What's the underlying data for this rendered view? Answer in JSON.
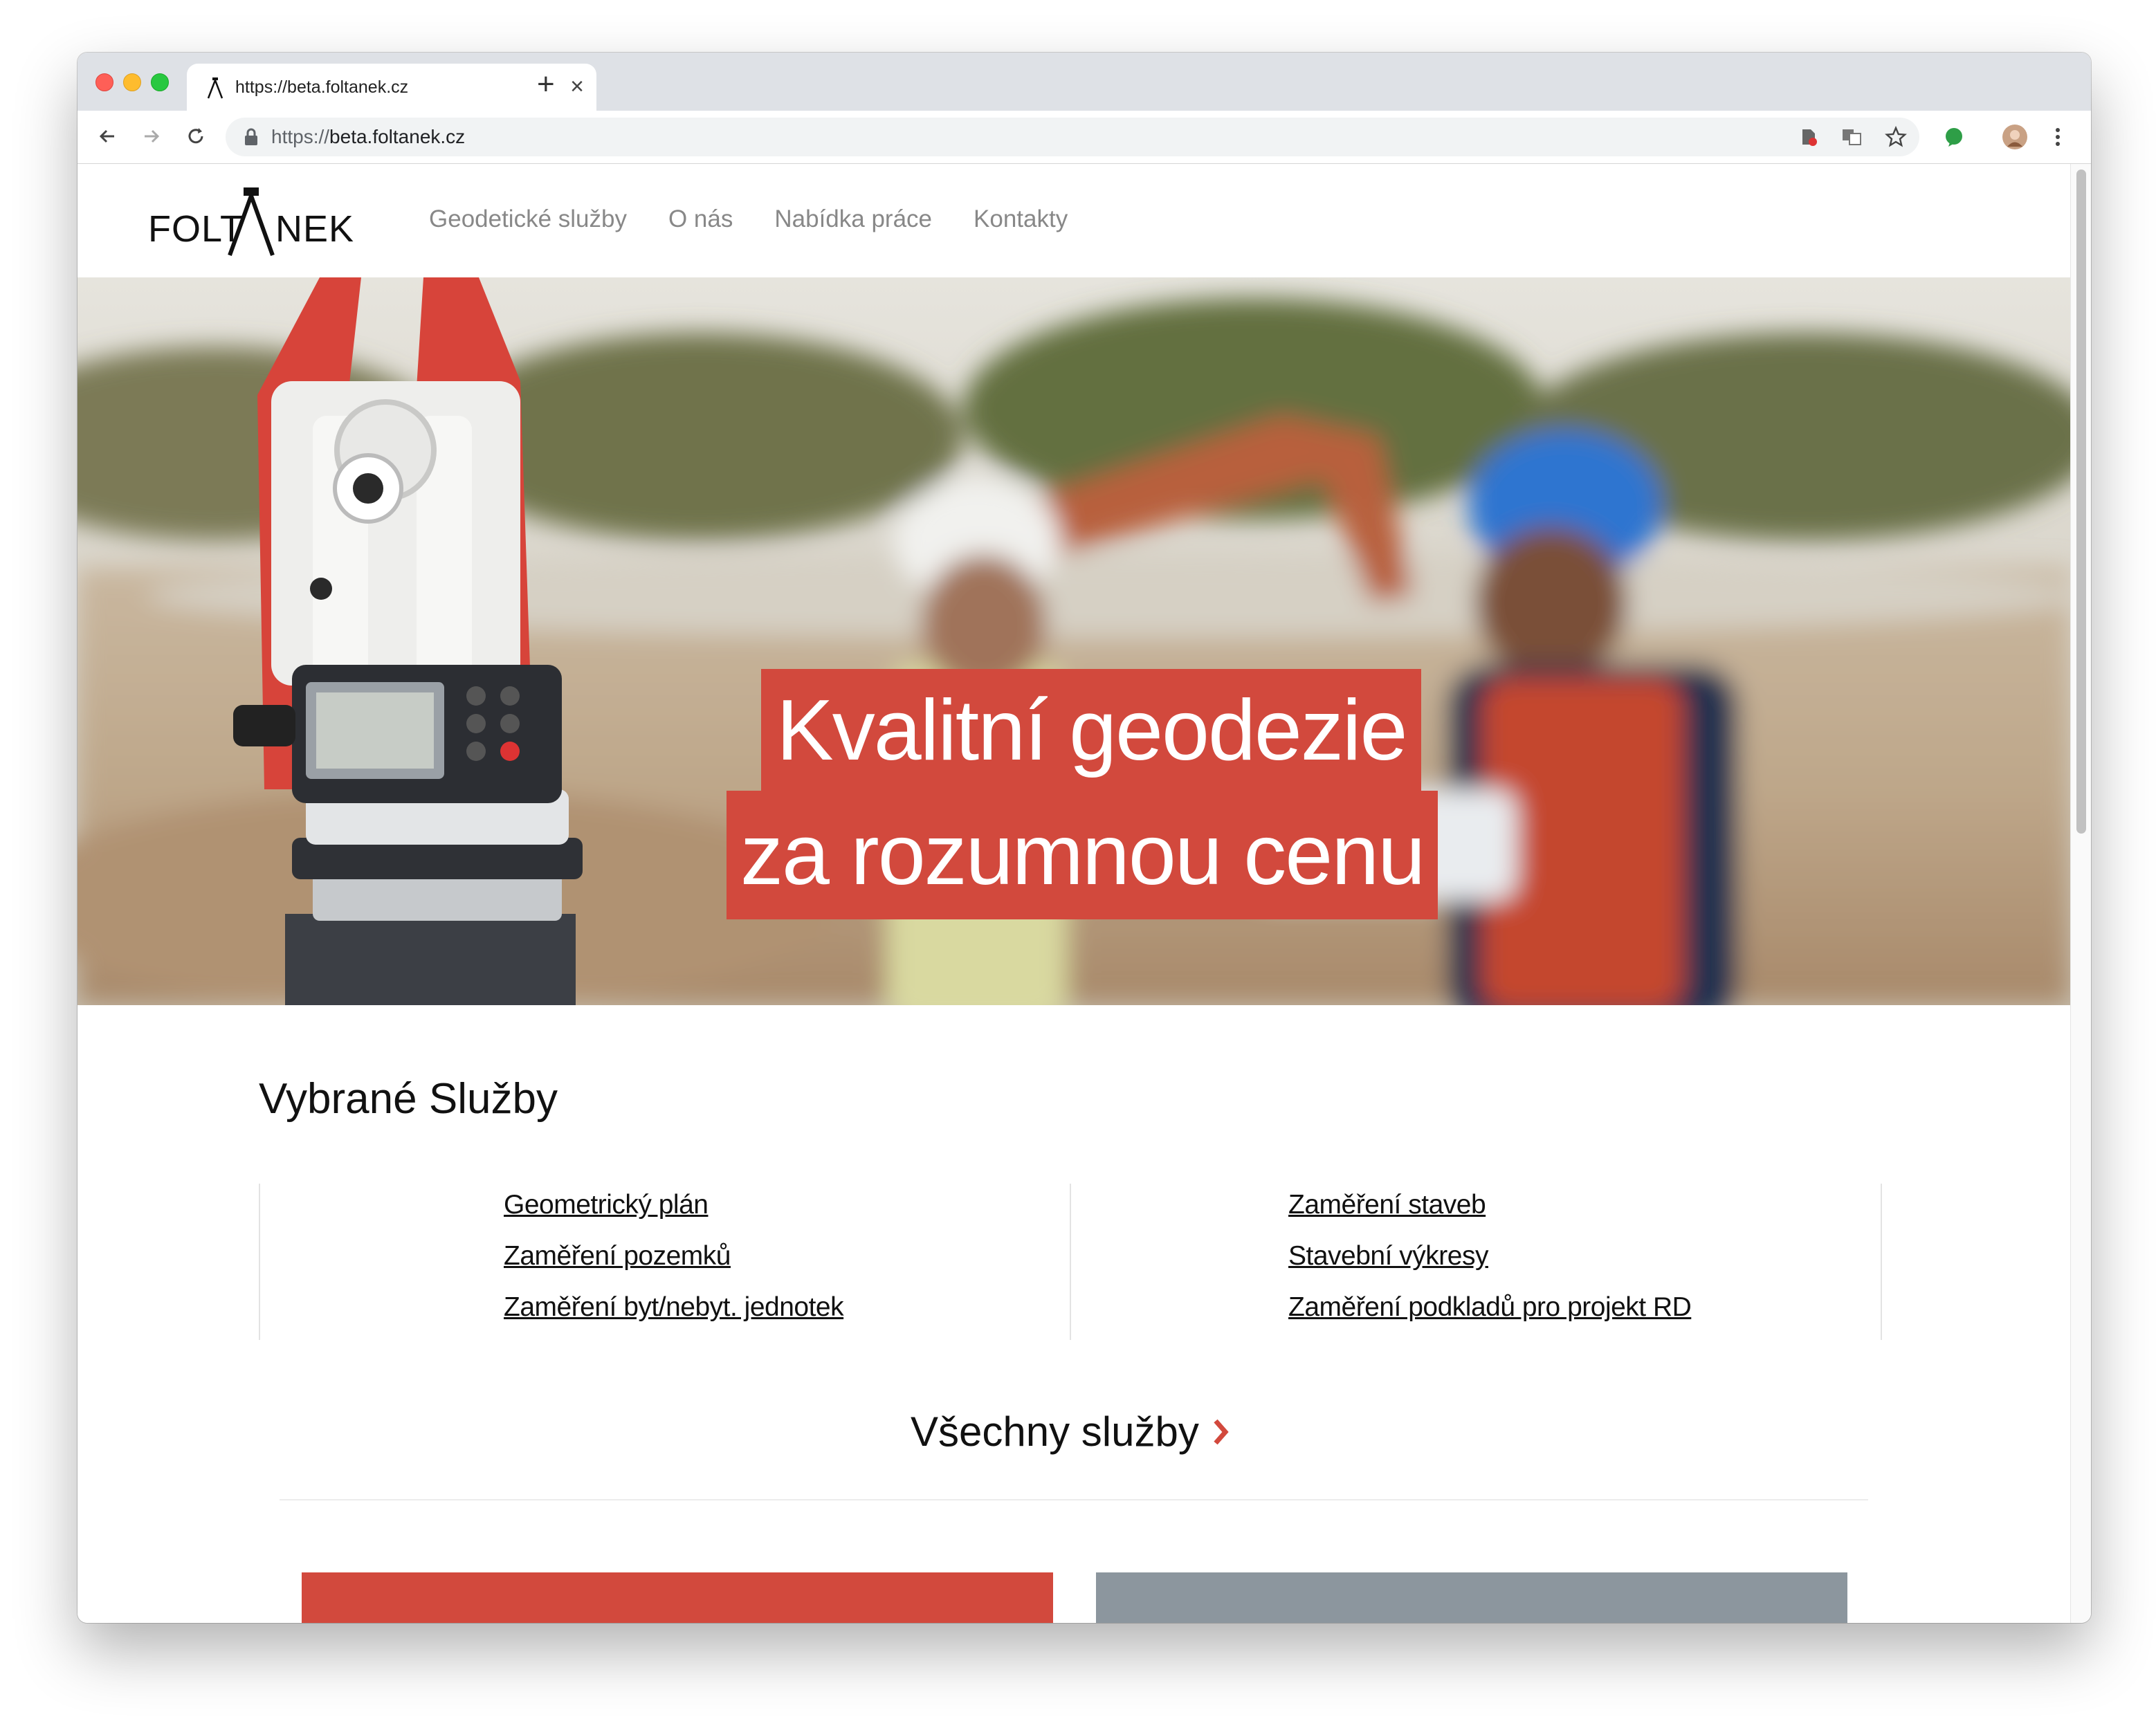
{
  "browser": {
    "tab_title": "https://beta.foltanek.cz",
    "url_scheme": "https://",
    "url_host": "beta.foltanek.cz",
    "icons": [
      "back-arrow-icon",
      "forward-arrow-icon",
      "reload-icon",
      "lock-icon",
      "extension-icon",
      "translate-icon",
      "star-icon",
      "green-extension-icon",
      "profile-avatar",
      "menu-dots-icon"
    ]
  },
  "site": {
    "logo_left": "FOLT",
    "logo_right": "NEK",
    "nav": [
      "Geodetické služby",
      "O nás",
      "Nabídka práce",
      "Kontakty"
    ]
  },
  "hero": {
    "line1": "Kvalitní geodezie",
    "line2": "za rozumnou cenu",
    "accent_color": "#d2493d"
  },
  "services": {
    "title": "Vybrané Služby",
    "left": [
      "Geometrický plán",
      "Zaměření pozemků",
      "Zaměření byt/nebyt. jednotek"
    ],
    "right": [
      "Zaměření staveb",
      "Stavební výkresy",
      "Zaměření podkladů pro projekt RD"
    ],
    "all_label": "Všechny služby"
  },
  "colors": {
    "card_red": "#d2493d",
    "card_gray": "#8c969e"
  }
}
